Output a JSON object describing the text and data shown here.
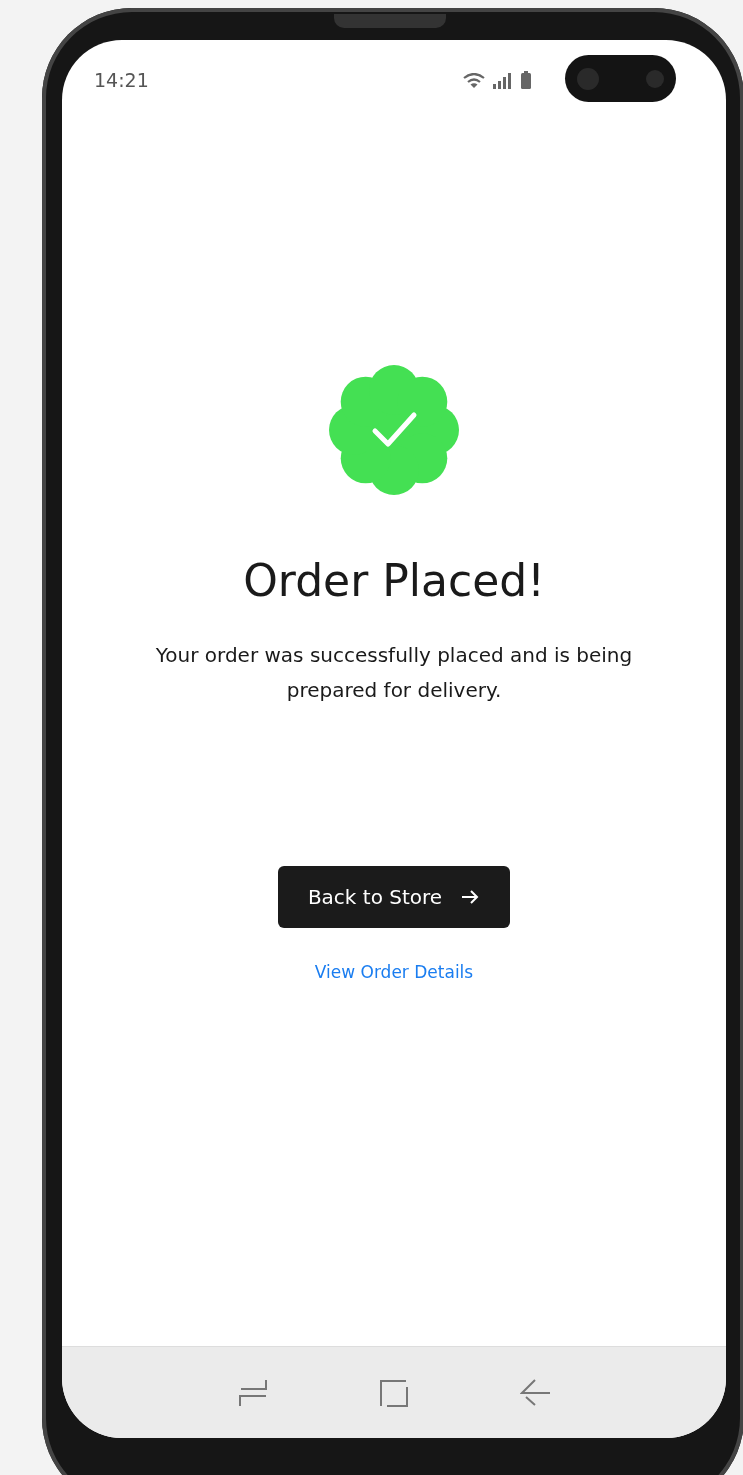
{
  "status_bar": {
    "time": "14:21"
  },
  "title": "Order Placed!",
  "message": "Your order was successfully placed and is being prepared for delivery.",
  "primary_button": {
    "label": "Back to Store"
  },
  "link": {
    "label": "View Order Details"
  }
}
